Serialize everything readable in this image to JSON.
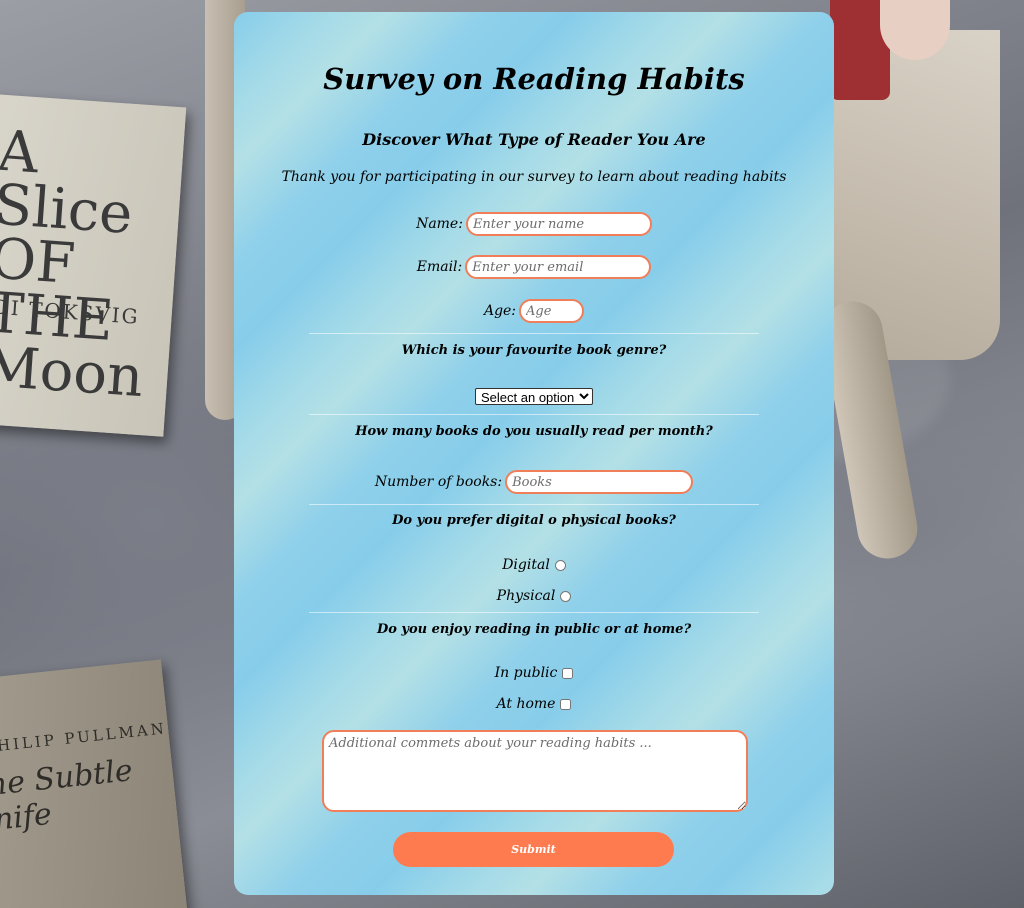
{
  "background": {
    "book1_title": "A Slice OF THE Moon",
    "book1_author": "DI TOKSVIG",
    "book2_author": "PHILIP PULLMAN",
    "book2_title": "The Subtle Knife"
  },
  "survey": {
    "title": "Survey on Reading Habits",
    "subtitle": "Discover What Type of Reader You Are",
    "description": "Thank you for participating in our survey to learn about reading habits",
    "name": {
      "label": "Name:",
      "placeholder": "Enter your name",
      "value": ""
    },
    "email": {
      "label": "Email:",
      "placeholder": "Enter your email",
      "value": ""
    },
    "age": {
      "label": "Age:",
      "placeholder": "Age",
      "value": ""
    },
    "genre": {
      "question": "Which is your favourite book genre?",
      "selected": "Select an option"
    },
    "books": {
      "question": "How many books do you usually read per month?",
      "label": "Number of books:",
      "placeholder": "Books",
      "value": ""
    },
    "format": {
      "question": "Do you prefer digital o physical books?",
      "options": [
        "Digital",
        "Physical"
      ]
    },
    "place": {
      "question": "Do you enjoy reading in public or at home?",
      "options": [
        "In public",
        "At home"
      ]
    },
    "comments": {
      "placeholder": "Additional commets about your reading habits ...",
      "value": ""
    },
    "submit_label": "Submit"
  },
  "colors": {
    "accent": "#fe7b50",
    "input_border": "#f07e58",
    "card_light": "#b3e0e6",
    "card_blue": "#87cdea"
  }
}
